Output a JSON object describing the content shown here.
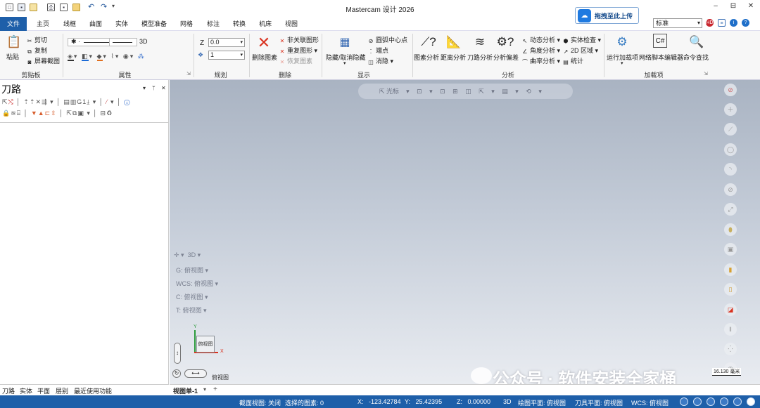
{
  "app": {
    "title": "Mastercam 设计 2026"
  },
  "window_controls": {
    "min": "–",
    "max": "⊟",
    "close": "✕"
  },
  "quick_access": {
    "undo": "↶",
    "redo": "↷",
    "more": "▾"
  },
  "upload_button": {
    "label": "拖拽至此上传"
  },
  "menu_tabs": [
    "文件",
    "主页",
    "线框",
    "曲面",
    "实体",
    "模型准备",
    "网格",
    "标注",
    "转换",
    "机床",
    "视图"
  ],
  "style_select": {
    "value": "标准"
  },
  "ribbon": {
    "clipboard": {
      "label": "剪贴板",
      "paste": "粘贴",
      "cut": "剪切",
      "copy": "复制",
      "screenshot": "屏幕截图"
    },
    "attributes": {
      "label": "属性",
      "mode_3d": "3D"
    },
    "plan": {
      "label": "规划",
      "z_label": "Z",
      "z_value": "0.0",
      "level_value": "1"
    },
    "delete": {
      "label": "删除",
      "delete_entities": "删除图素",
      "nonassoc": "非关联图形",
      "duplicate": "重复图形",
      "restore": "恢复图素"
    },
    "display": {
      "label": "显示",
      "hide_unhide": "隐藏/取消隐藏",
      "arc_center": "圆弧中心点",
      "endpoints": "端点",
      "blank": "消隐"
    },
    "analyze": {
      "label": "分析",
      "entity_analysis": "图素分析",
      "distance": "距离分析",
      "toolpath": "刀路分析",
      "deviation": "分析偏差",
      "dynamic": "动态分析",
      "angle": "角度分析",
      "curvature": "曲率分析",
      "solid_check": "实体检查",
      "area_2d": "2D 区域",
      "stats": "统计"
    },
    "addins": {
      "label": "加载项",
      "run": "运行加载项",
      "net_editor": "网络脚本编辑器",
      "cmd_find": "命令查找"
    }
  },
  "left_panel": {
    "title": "刀路",
    "tabs": [
      "刀路",
      "实体",
      "平面",
      "层别",
      "最近使用功能"
    ]
  },
  "viewport": {
    "floating_bar_text": "光标",
    "view_mode": "3D",
    "g_label": "G:",
    "g_value": "俯视图",
    "wcs_label": "WCS:",
    "wcs_value": "俯视图",
    "c_label": "C:",
    "c_value": "俯视图",
    "t_label": "T:",
    "t_value": "俯视图",
    "view_name": "俯视图",
    "cube_label": "俯视图",
    "scale": "16.130 毫米",
    "watermark": "公众号 · 软件安装全家桶"
  },
  "view_tabs": {
    "active": "视图单-1",
    "add": "+"
  },
  "status_bar": {
    "section_view": "截面视图: 关闭",
    "selected": "选择的图素: 0",
    "x_label": "X:",
    "x_value": "-123.42784",
    "y_label": "Y:",
    "y_value": "25.42395",
    "z_label": "Z:",
    "z_value": "0.00000",
    "mode": "3D",
    "draw_plane": "绘图平面: 俯视图",
    "tool_plane": "刀具平面: 俯视图",
    "wcs": "WCS: 俯视图"
  },
  "colors": {
    "accent": "#1e5fa9",
    "delete_red": "#d9321f",
    "upload_blue": "#1f7ae0"
  }
}
